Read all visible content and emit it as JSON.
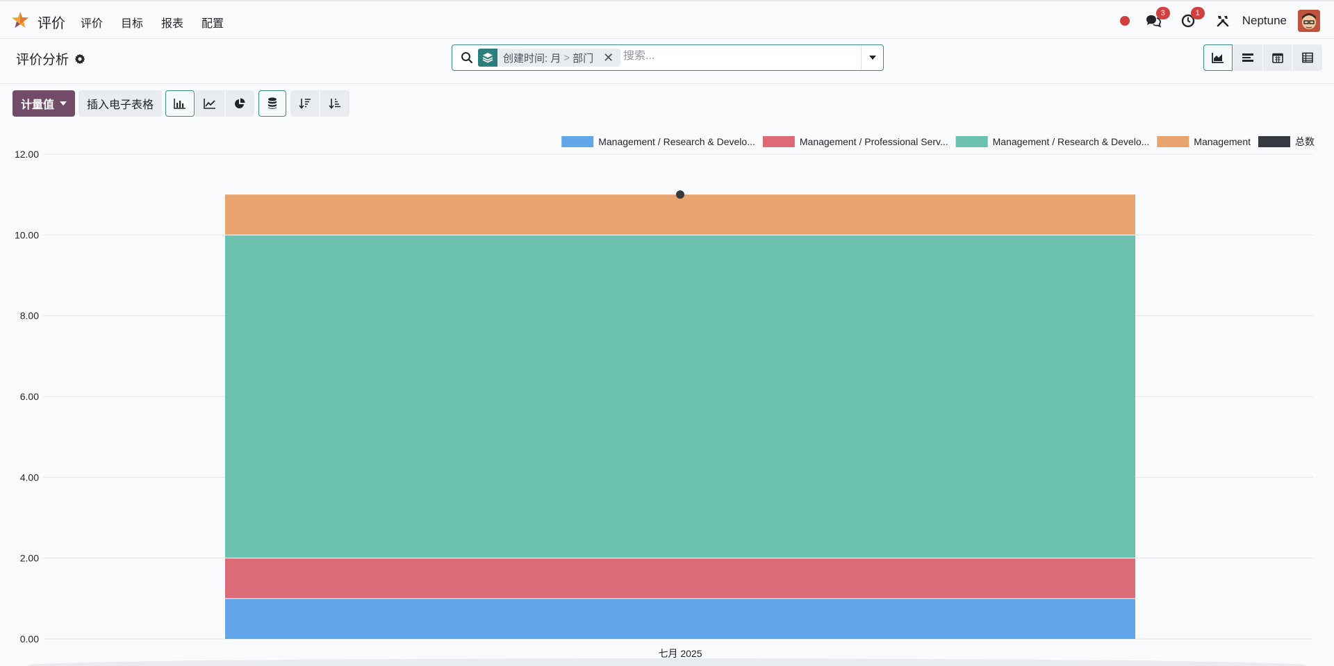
{
  "navbar": {
    "app_name": "评价",
    "menu": [
      "评价",
      "目标",
      "报表",
      "配置"
    ],
    "messages_count": "3",
    "activities_count": "1",
    "company": "Neptune"
  },
  "control": {
    "breadcrumb": "评价分析",
    "facet_part1": "创建时间: 月",
    "facet_sep": ">",
    "facet_part2": "部门",
    "facet_close": "✕",
    "search_placeholder": "搜索..."
  },
  "toolbar": {
    "measure_label": "计量值",
    "spreadsheet_label": "插入电子表格"
  },
  "colors": {
    "primary": "#714b67",
    "accent": "#3a8a85",
    "blue": "#62a6ea",
    "red": "#dc6a77",
    "teal": "#6bc1ae",
    "orange": "#eaa46f",
    "dark": "#343a40"
  },
  "chart_data": {
    "type": "bar",
    "stacked": true,
    "categories": [
      "七月 2025"
    ],
    "series": [
      {
        "name": "Management / Research & Develo...",
        "values": [
          1
        ],
        "color": "#62a6ea"
      },
      {
        "name": "Management / Professional Serv...",
        "values": [
          1
        ],
        "color": "#dc6a77"
      },
      {
        "name": "Management / Research & Develo...",
        "values": [
          8
        ],
        "color": "#6bc1ae"
      },
      {
        "name": "Management",
        "values": [
          1
        ],
        "color": "#eaa46f"
      }
    ],
    "total": {
      "name": "总数",
      "values": [
        11
      ],
      "color": "#343a40"
    },
    "y_ticks": [
      "0.00",
      "2.00",
      "4.00",
      "6.00",
      "8.00",
      "10.00",
      "12.00"
    ],
    "ylim": [
      0,
      12
    ],
    "grid": true,
    "legend_position": "top-right"
  }
}
